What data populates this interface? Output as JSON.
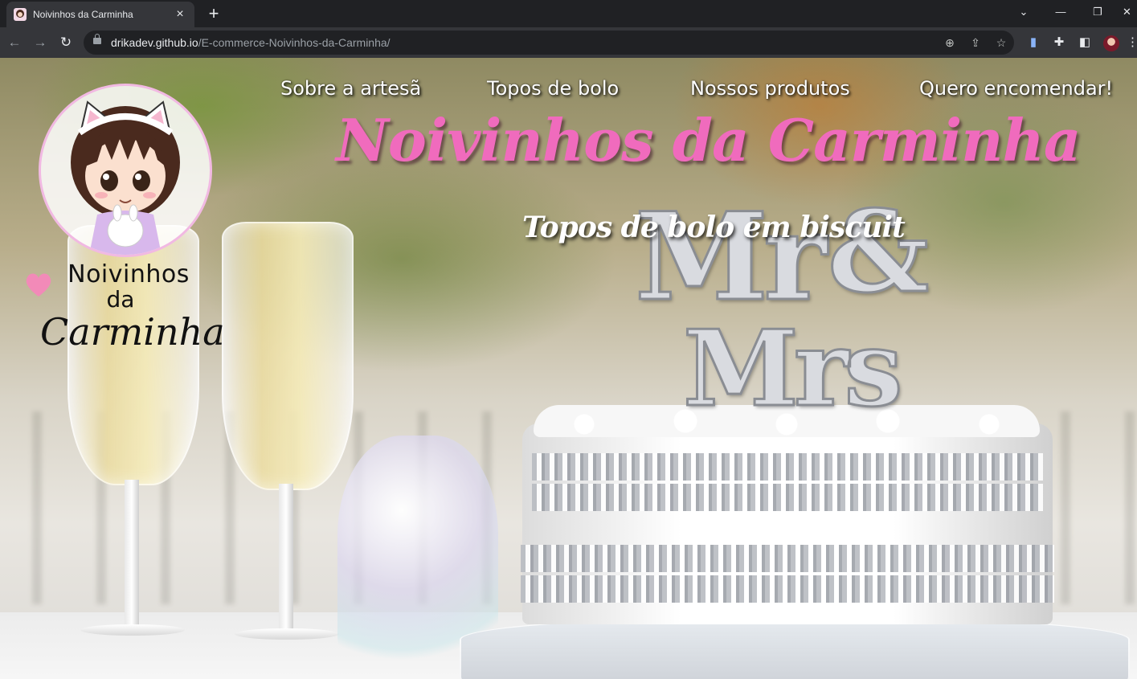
{
  "browser": {
    "tab_title": "Noivinhos da Carminha",
    "tab_close_icon": "×",
    "new_tab_icon": "+",
    "url_host": "drikadev.github.io",
    "url_path": "/E-commerce-Noivinhos-da-Carminha/",
    "window_controls": {
      "dropdown": "⌄",
      "minimize": "—",
      "restore": "❐",
      "close": "✕"
    },
    "nav_icons": {
      "back": "←",
      "forward": "→",
      "reload": "↻"
    },
    "omnibox_icons": {
      "zoom": "⊕",
      "share": "⇪",
      "bookmark": "☆"
    },
    "toolbar_icons": {
      "extension_1": "▮",
      "extensions": "✚",
      "side_panel": "◧",
      "menu": "⋮"
    }
  },
  "site": {
    "nav": [
      "Sobre a artesã",
      "Topos de bolo",
      "Nossos produtos",
      "Quero encomendar!"
    ],
    "hero_title": "Noivinhos da Carminha",
    "hero_subtitle": "Topos de bolo em biscuit",
    "logo": {
      "line1": "Noivinhos",
      "line2": "da",
      "line3": "Carminha"
    },
    "topper": {
      "top": "Mr",
      "amp": "&",
      "bottom": "Mrs"
    },
    "colors": {
      "brand_pink": "#f06bbd",
      "logo_ring": "#f1b9e2",
      "heart": "#f28ab8"
    }
  }
}
